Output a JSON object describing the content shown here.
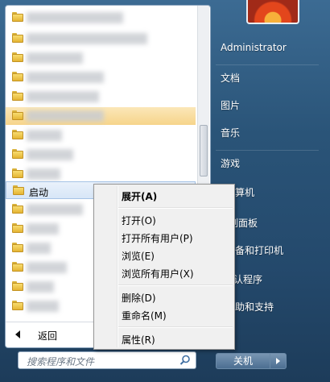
{
  "programs": [
    {
      "label": "Microsoft Silverlight",
      "obscured": true
    },
    {
      "label": "Microsoft Silverlight",
      "obscured": true
    },
    {
      "label": "",
      "obscured": true
    },
    {
      "label": "V...13",
      "obscured": true
    },
    {
      "label": "W...",
      "obscured": true
    },
    {
      "label": "",
      "obscured": true,
      "selected": true
    },
    {
      "label": "",
      "obscured": true
    },
    {
      "label": "",
      "obscured": true
    },
    {
      "label": "",
      "obscured": true
    },
    {
      "label": "启动",
      "obscured": false,
      "hover": true
    },
    {
      "label": "",
      "obscured": true
    },
    {
      "label": "",
      "obscured": true
    },
    {
      "label": "",
      "obscured": true
    },
    {
      "label": "",
      "obscured": true
    },
    {
      "label": "",
      "obscured": true
    },
    {
      "label": "",
      "obscured": true
    },
    {
      "label": "",
      "obscured": true
    }
  ],
  "back_label": "返回",
  "search": {
    "placeholder": "搜索程序和文件"
  },
  "right_items": [
    "Administrator",
    "文档",
    "图片",
    "音乐",
    "游戏",
    "计算机",
    "控制面板",
    "设备和打印机",
    "默认程序",
    "帮助和支持"
  ],
  "right_items_visible": [
    "Administrator",
    "文档",
    "图片",
    "音乐",
    "游戏",
    "算机",
    "制面板",
    "备和打印机",
    "认程序",
    "助和支持"
  ],
  "shutdown_label": "关机",
  "context_menu": {
    "items": [
      {
        "label": "展开(A)",
        "bold": true
      },
      {
        "sep": true
      },
      {
        "label": "打开(O)"
      },
      {
        "label": "打开所有用户(P)"
      },
      {
        "label": "浏览(E)"
      },
      {
        "label": "浏览所有用户(X)"
      },
      {
        "sep": true
      },
      {
        "label": "删除(D)"
      },
      {
        "label": "重命名(M)"
      },
      {
        "sep": true
      },
      {
        "label": "属性(R)"
      }
    ]
  },
  "colors": {
    "selected_row": "#f6d48b",
    "hover_row": "#d7e6f7",
    "menu_bg": "#f0f0f0"
  }
}
